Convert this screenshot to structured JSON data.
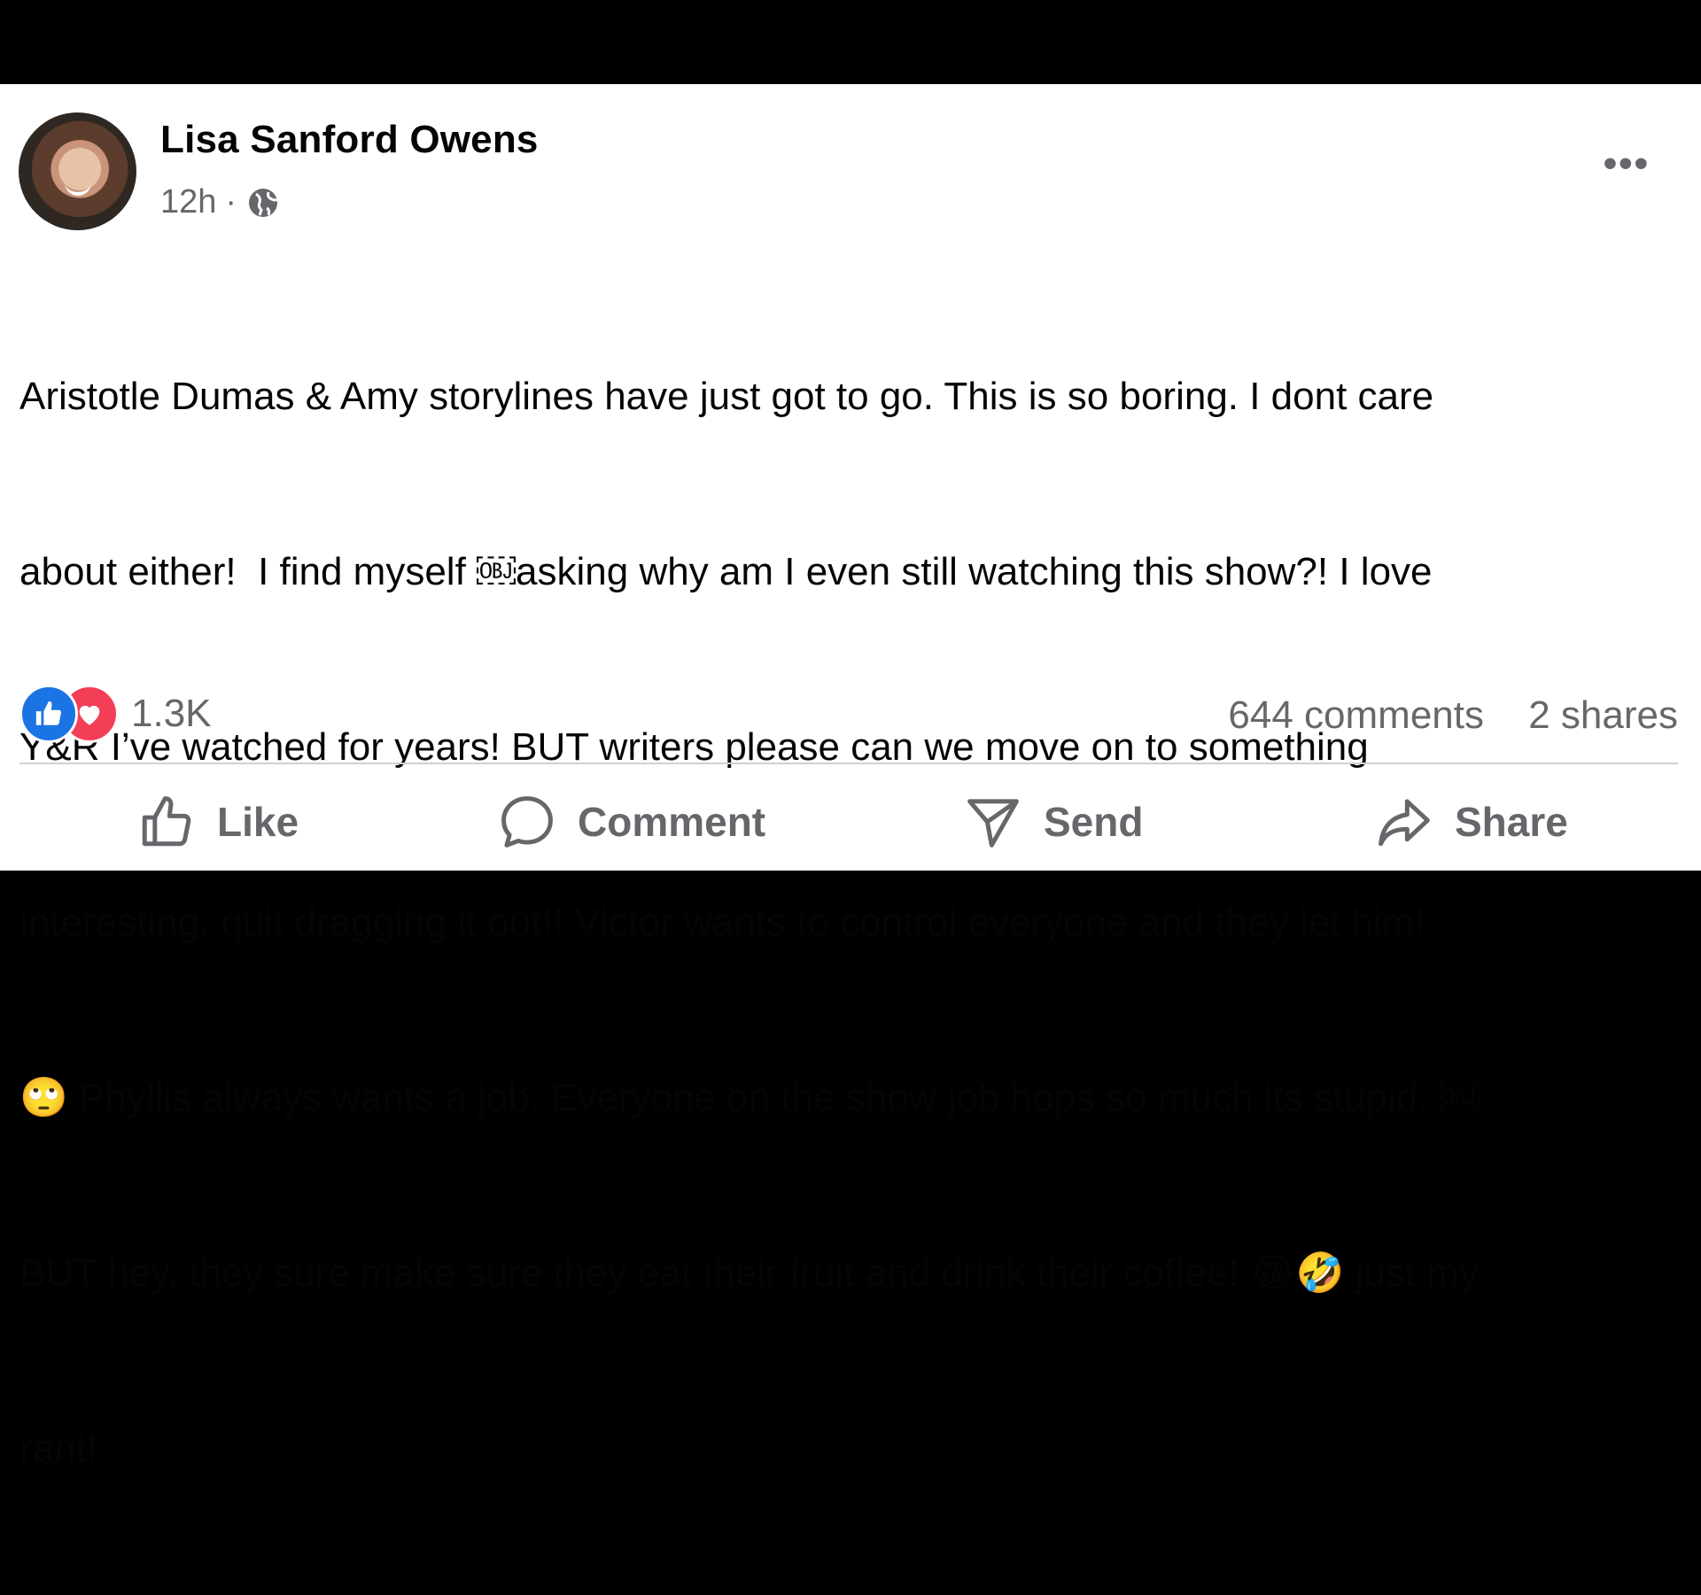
{
  "post": {
    "author": "Lisa Sanford Owens",
    "time": "12h",
    "separator": "·",
    "body_lines": [
      "Aristotle Dumas & Amy storylines have just got to go. This is so boring. I dont care",
      "about either!  I find myself ￼asking why am I even still watching this show?! I love",
      "Y&R I’ve watched for years! BUT writers please can we move on to something",
      "interesting, quit dragging it out!! Victor wants to control everyone and they let him!",
      "🙄 Phyllis always wants a job. Everyone on the show job hops so much its stupid. ￼",
      "BUT hey, they sure make sure they eat their fruit and drink their coffee! 😂🤣 just my",
      "rant!"
    ]
  },
  "stats": {
    "reaction_count": "1.3K",
    "comments": "644 comments",
    "shares": "2 shares"
  },
  "actions": {
    "like": "Like",
    "comment": "Comment",
    "send": "Send",
    "share": "Share"
  },
  "colors": {
    "like_blue": "#1b74e4",
    "love_red": "#f33e58",
    "secondary_text": "#65676b"
  },
  "icons": [
    "avatar",
    "globe-icon",
    "more-icon",
    "like-reaction-icon",
    "love-reaction-icon",
    "like-icon",
    "comment-icon",
    "send-icon",
    "share-icon"
  ]
}
